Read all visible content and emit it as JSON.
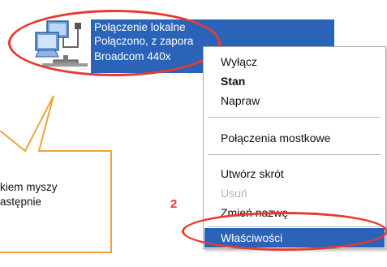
{
  "connection": {
    "name": "Połączenie lokalne",
    "status": "Połączono, z zapora",
    "adapter": "Broadcom 440x"
  },
  "icons": {
    "network_icon": "network-connection-icon"
  },
  "context_menu": {
    "items": [
      {
        "label": "Wyłącz",
        "style": "normal"
      },
      {
        "label": "Stan",
        "style": "bold"
      },
      {
        "label": "Napraw",
        "style": "normal"
      },
      {
        "label": "Połączenia mostkowe",
        "style": "normal"
      },
      {
        "label": "Utwórz skrót",
        "style": "normal"
      },
      {
        "label": "Usuń",
        "style": "disabled"
      },
      {
        "label": "Zmień nazwę",
        "style": "normal"
      },
      {
        "label": "Właściwości",
        "style": "selected"
      }
    ]
  },
  "annotations": {
    "step_number": "2",
    "callout_lines": [
      "kiem myszy",
      "astępnie"
    ]
  },
  "colors": {
    "selection": "#2a63b8",
    "highlight_ring": "#e83a2e",
    "callout_border": "#f0a23a"
  }
}
